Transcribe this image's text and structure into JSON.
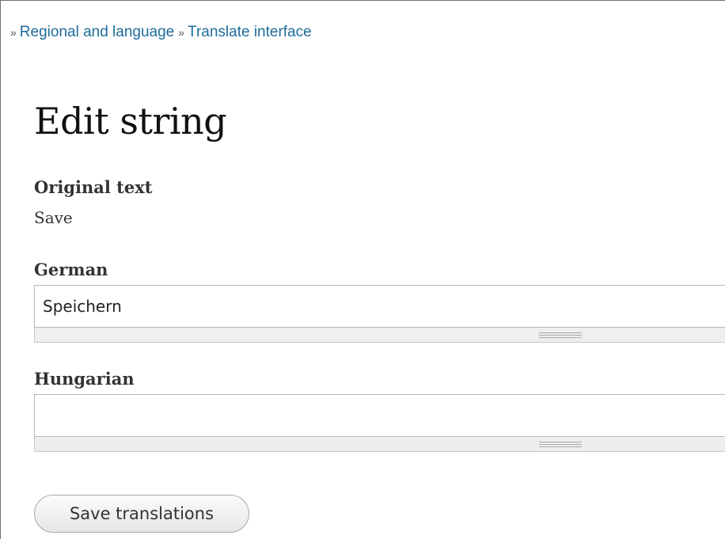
{
  "breadcrumb": {
    "separator": "»",
    "items": [
      {
        "label": "Regional and language"
      },
      {
        "label": "Translate interface"
      }
    ]
  },
  "page_title": "Edit string",
  "original": {
    "label": "Original text",
    "value": "Save"
  },
  "translations": [
    {
      "label": "German",
      "value": "Speichern"
    },
    {
      "label": "Hungarian",
      "value": ""
    }
  ],
  "actions": {
    "save_label": "Save translations"
  },
  "colors": {
    "link": "#1f6b9c",
    "text": "#333333",
    "grippie_bg": "#eeeeee"
  }
}
